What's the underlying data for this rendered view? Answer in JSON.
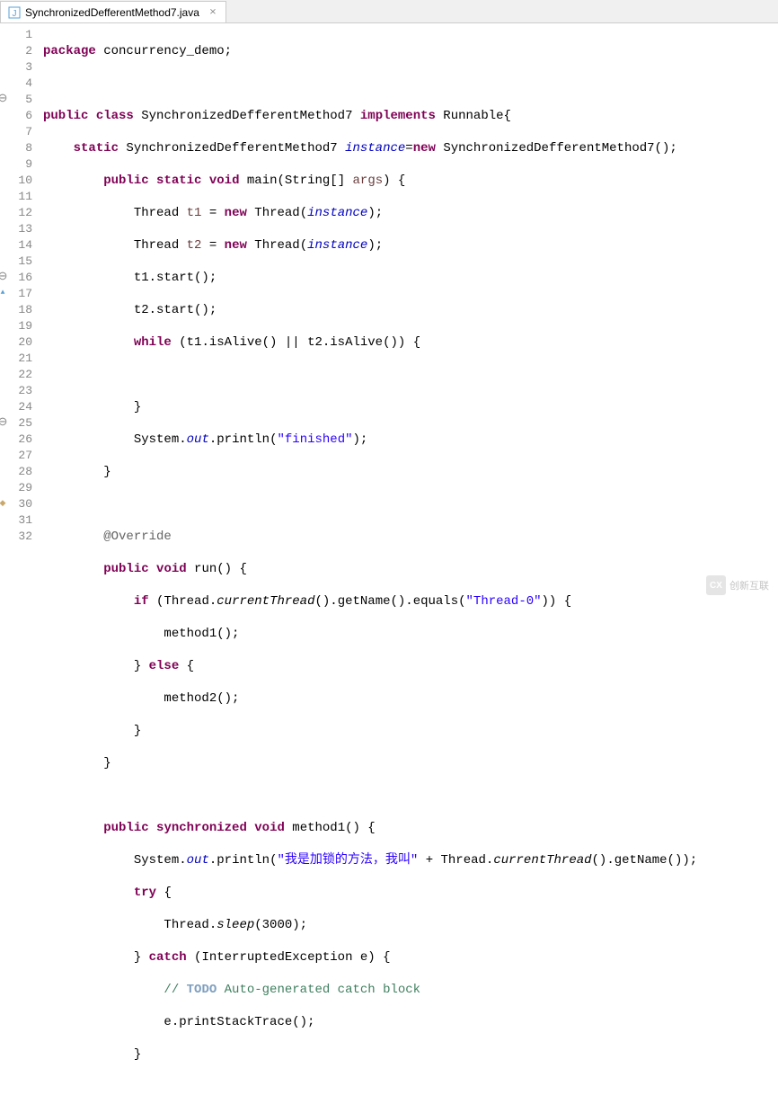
{
  "tab": {
    "filename": "SynchronizedDefferentMethod7.java",
    "close_glyph": "⨯"
  },
  "gutter": {
    "lines": [
      "1",
      "2",
      "3",
      "4",
      "5",
      "6",
      "7",
      "8",
      "9",
      "10",
      "11",
      "12",
      "13",
      "14",
      "15",
      "16",
      "17",
      "18",
      "19",
      "20",
      "21",
      "22",
      "23",
      "24",
      "25",
      "26",
      "27",
      "28",
      "29",
      "30",
      "31",
      "32"
    ],
    "fold_markers": {
      "5": "⊖",
      "16": "⊖",
      "25": "⊖"
    },
    "override_markers": {
      "17": "▲"
    },
    "warn_markers": {
      "30": "◆"
    }
  },
  "code": {
    "kw_package": "package",
    "pkg_name": " concurrency_demo;",
    "kw_public": "public",
    "kw_class": "class",
    "class_name": " SynchronizedDefferentMethod7 ",
    "kw_implements": "implements",
    "iface": " Runnable{",
    "kw_static": "static",
    "type_class": " SynchronizedDefferentMethod7 ",
    "field_instance": "instance",
    "eq": "=",
    "kw_new": "new",
    "ctor_call": " SynchronizedDefferentMethod7();",
    "kw_void": "void",
    "main_sig": " main(String[] ",
    "args": "args",
    "sig_close": ") {",
    "thread_t1_a": "            Thread ",
    "t1": "t1",
    "thread_t1_b": " = ",
    "thread_t1_c": " Thread(",
    "thread_t1_d": ");",
    "thread_t2_a": "            Thread ",
    "t2": "t2",
    "t1_start": "            t1.start();",
    "t2_start": "            t2.start();",
    "kw_while": "while",
    "while_cond": " (t1.isAlive() || t2.isAlive()) {",
    "empty_brace": "            }",
    "sys": "System.",
    "out": "out",
    "println": ".println(",
    "str_finished": "\"finished\"",
    "close_paren": ");",
    "brace_close_m": "        }",
    "ann_override": "@Override",
    "run_sig": " run() {",
    "kw_if": "if",
    "if_cond": " (Thread.",
    "curThread": "currentThread",
    "if_cond2": "().getName().equals(",
    "str_t0": "\"Thread-0\"",
    "if_cond3": ")) {",
    "m1_call": "                method1();",
    "kw_else": "else",
    "else_open": " {",
    "m2_call": "                method2();",
    "brace_close_if": "            }",
    "kw_synchronized": "synchronized",
    "m1_sig": " method1() {",
    "str_cn": "\"我是加锁的方法，我叫\"",
    "plus": " + Thread.",
    "getName_call": "().getName());",
    "kw_try": "try",
    "try_open": " {",
    "sleep_a": "                Thread.",
    "sleep": "sleep",
    "sleep_b": "(3000);",
    "kw_catch": "catch",
    "catch_sig": " (InterruptedException e) {",
    "todo_comment": "TODO",
    "todo_rest": " Auto-generated catch block",
    "pst": "                e.printStackTrace();",
    "last_brace": "            }"
  },
  "watermark": {
    "text": "创新互联",
    "logo": "CX"
  }
}
